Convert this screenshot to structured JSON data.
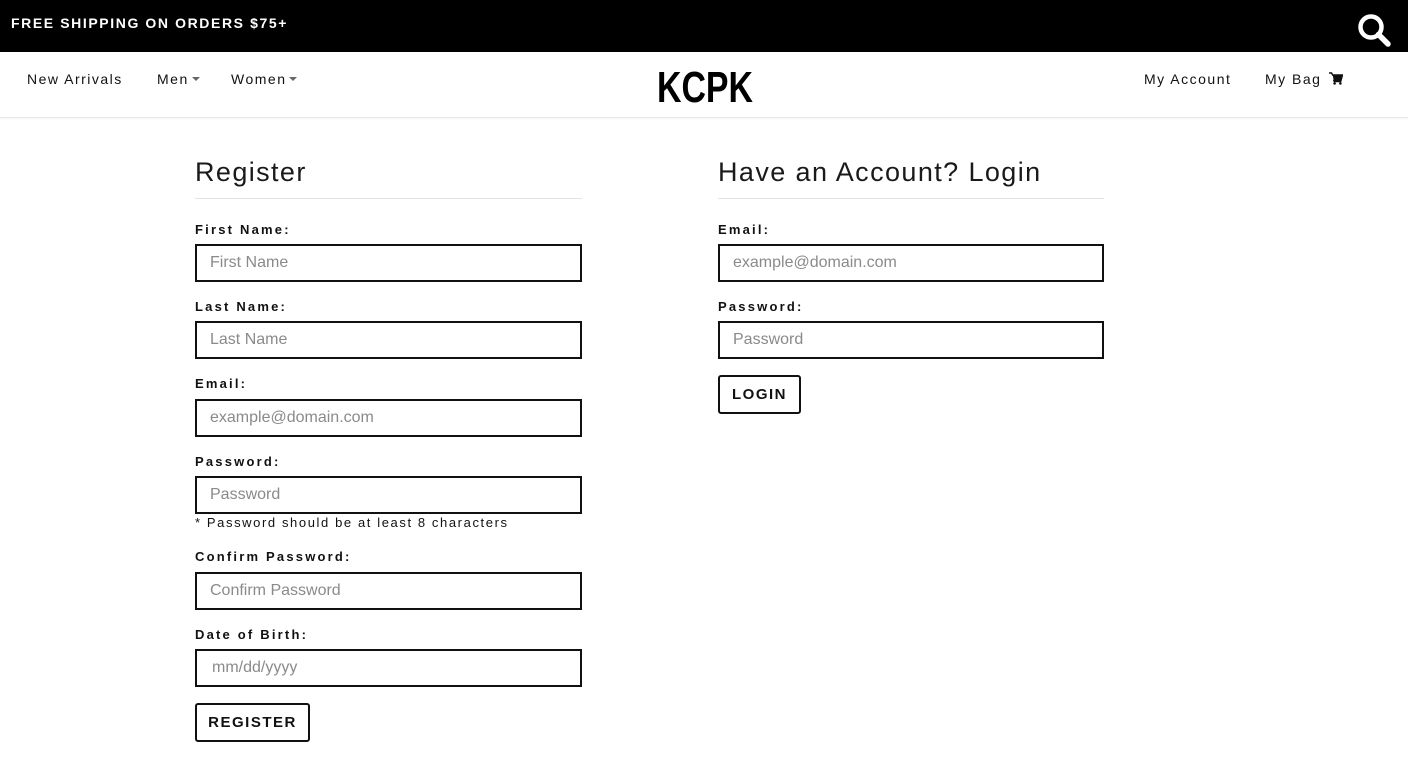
{
  "topbar": {
    "promo_text": "FREE SHIPPING ON ORDERS $75+",
    "search_icon": "search-icon"
  },
  "nav": {
    "new_arrivals": "New Arrivals",
    "men": "Men",
    "women": "Women",
    "logo": "KCPK",
    "my_account": "My Account",
    "my_bag": "My Bag",
    "cart_icon": "shopping-cart-icon"
  },
  "register": {
    "title": "Register",
    "first_name_label": "First Name:",
    "first_name_placeholder": "First Name",
    "last_name_label": "Last Name:",
    "last_name_placeholder": "Last Name",
    "email_label": "Email:",
    "email_placeholder": "example@domain.com",
    "password_label": "Password:",
    "password_placeholder": "Password",
    "password_note": "* Password should be at least 8 characters",
    "confirm_password_label": "Confirm Password:",
    "confirm_password_placeholder": "Confirm Password",
    "dob_label": "Date of Birth:",
    "dob_placeholder": "mm/dd/yyyy",
    "submit_label": "REGISTER"
  },
  "login": {
    "title": "Have an Account? Login",
    "email_label": "Email:",
    "email_placeholder": "example@domain.com",
    "password_label": "Password:",
    "password_placeholder": "Password",
    "submit_label": "LOGIN"
  }
}
